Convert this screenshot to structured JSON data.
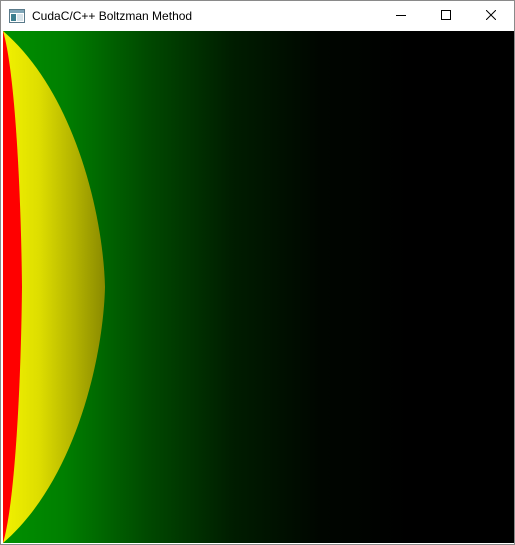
{
  "window": {
    "title": "CudaC/C++ Boltzman Method",
    "icon": "application-window-icon",
    "controls": {
      "minimize_icon": "minimize-icon",
      "maximize_icon": "maximize-icon",
      "close_icon": "close-icon"
    }
  },
  "visualization": {
    "description_colors": {
      "background": "#000000",
      "field_near": "#008000",
      "front": "#e6e600",
      "source": "#ff0000"
    }
  }
}
